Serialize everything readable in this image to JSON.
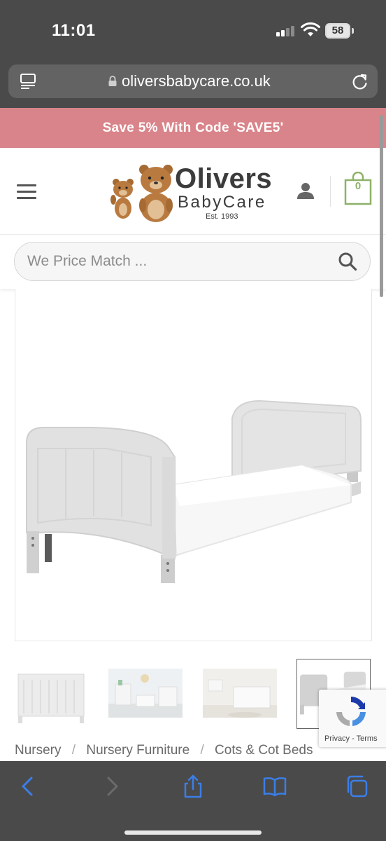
{
  "status_bar": {
    "time": "11:01",
    "battery": "58"
  },
  "browser": {
    "url": "oliversbabycare.co.uk"
  },
  "promo": {
    "text": "Save 5% With Code 'SAVE5'"
  },
  "header": {
    "logo_title": "Olivers",
    "logo_subtitle": "BabyCare",
    "logo_est": "Est. 1993",
    "cart_count": "0"
  },
  "search": {
    "placeholder": "We Price Match ..."
  },
  "recaptcha": {
    "privacy": "Privacy",
    "separator": " - ",
    "terms": "Terms"
  },
  "breadcrumb": {
    "items": [
      "Nursery",
      "Nursery Furniture",
      "Cots & Cot Beds"
    ],
    "separator": "/"
  },
  "colors": {
    "promo_bg": "#d9848a",
    "accent_green": "#8eb168",
    "browser_chrome": "#4a4a4a",
    "toolbar_icons": "#3b7ee8"
  },
  "icons": {
    "reader": "reader-icon",
    "lock": "lock-icon",
    "reload": "reload-icon",
    "menu": "hamburger-icon",
    "account": "account-icon",
    "cart": "cart-icon",
    "search": "search-icon",
    "back": "back-icon",
    "forward": "forward-icon",
    "share": "share-icon",
    "bookmarks": "bookmarks-icon",
    "tabs": "tabs-icon"
  }
}
